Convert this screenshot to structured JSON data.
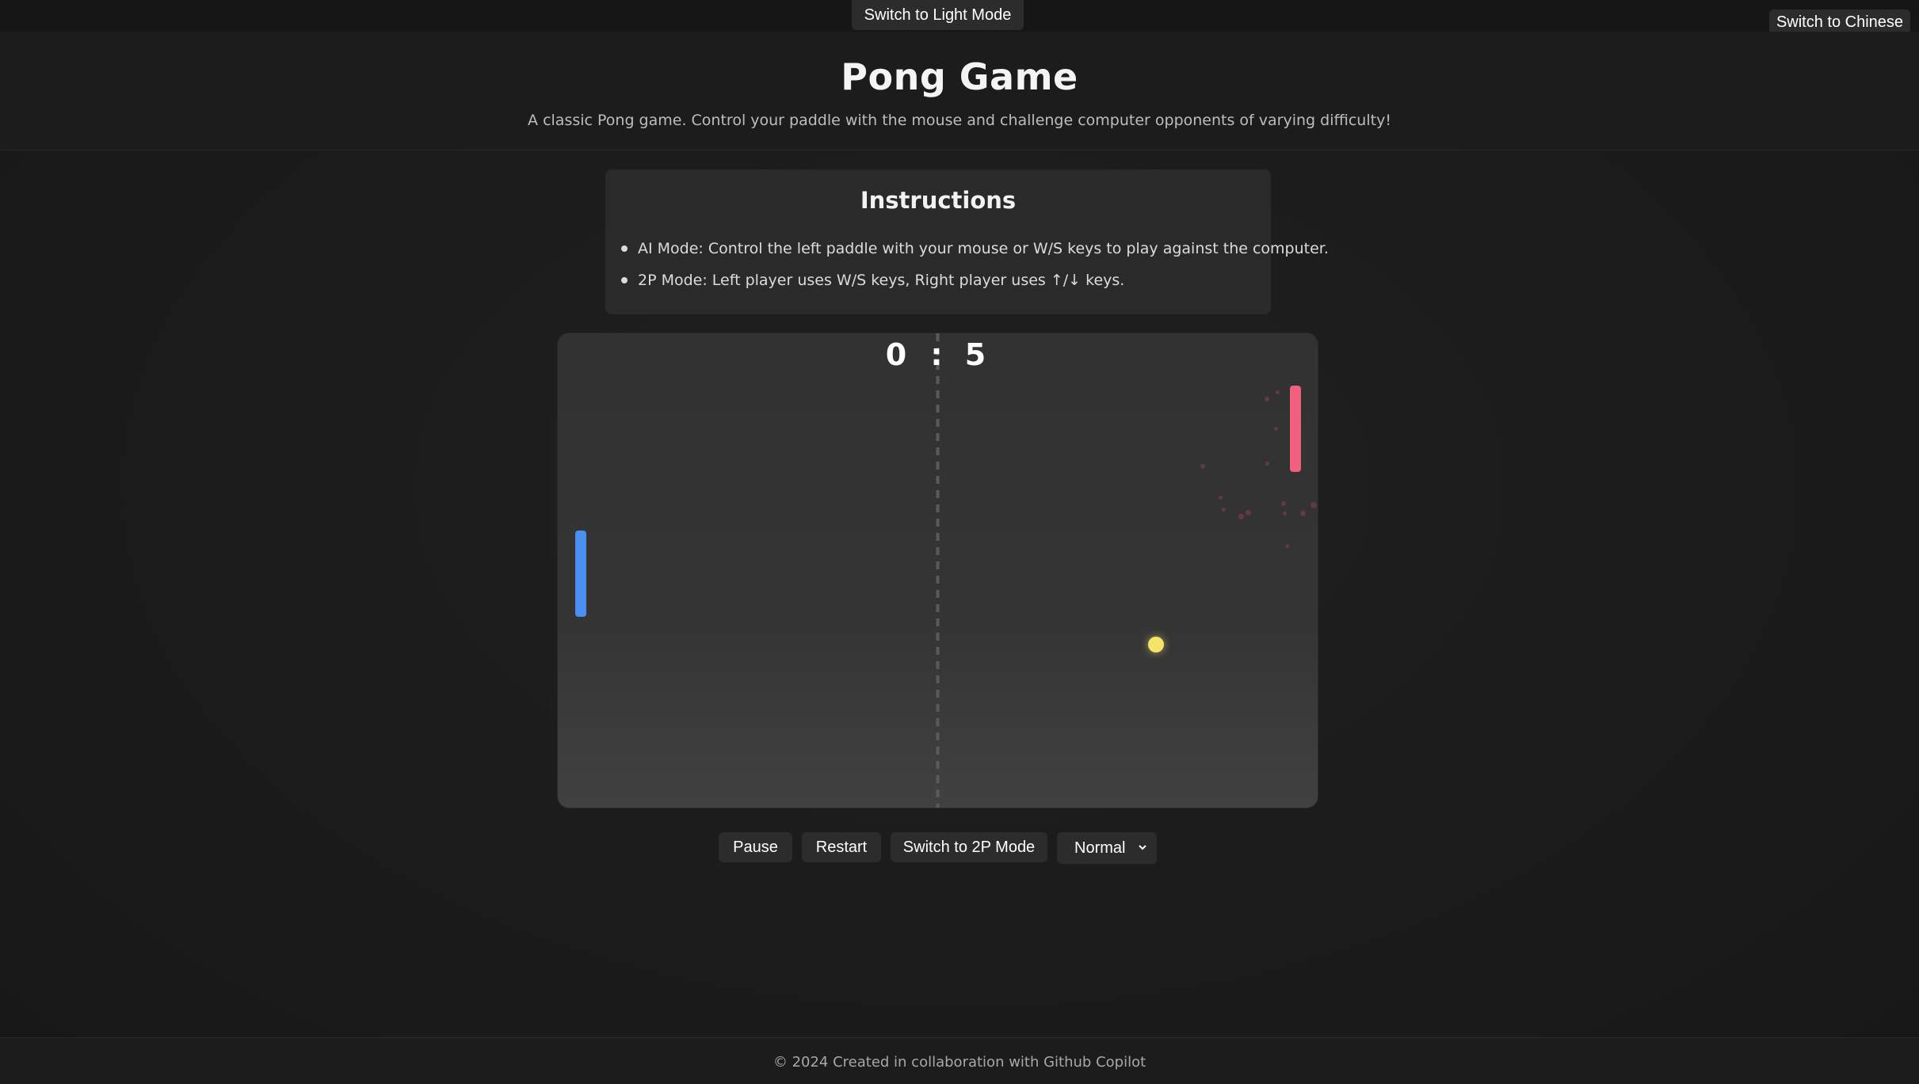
{
  "top_bar": {
    "theme_toggle_label": "Switch to Light Mode",
    "language_toggle_label": "Switch to Chinese"
  },
  "header": {
    "title": "Pong Game",
    "subtitle": "A classic Pong game. Control your paddle with the mouse and challenge computer opponents of varying difficulty!"
  },
  "instructions": {
    "title": "Instructions",
    "items": [
      "AI Mode: Control the left paddle with your mouse or W/S keys to play against the computer.",
      "2P Mode: Left player uses W/S keys, Right player uses ↑/↓ keys."
    ]
  },
  "game": {
    "score_left": "0",
    "score_separator": ":",
    "score_right": "5",
    "colors": {
      "left_paddle": "#4a8ff0",
      "right_paddle": "#f0607f",
      "ball": "#f6e36a",
      "center_line": "#5a5a5a"
    }
  },
  "controls": {
    "pause_label": "Pause",
    "restart_label": "Restart",
    "mode_label": "Switch to 2P Mode",
    "difficulty_selected": "Normal"
  },
  "footer": {
    "text": "© 2024 Created in collaboration with Github Copilot"
  }
}
